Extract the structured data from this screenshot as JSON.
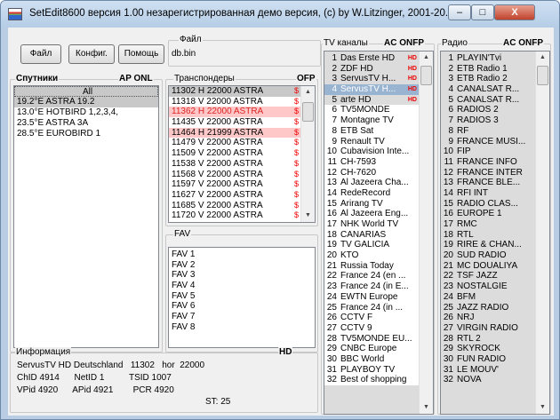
{
  "window": {
    "title": "SetEdit8600 версия  1.00  незарегистрированная демо версия, (c) by W.Litzinger, 2001-20...",
    "controls": {
      "minimize": "–",
      "maximize": "□",
      "close": "X"
    }
  },
  "toolbar": {
    "file_label": "Файл",
    "config_label": "Конфиг.",
    "help_label": "Помощь"
  },
  "file_box": {
    "label": "Файл",
    "value": "db.bin"
  },
  "satellites": {
    "label": "Спутники",
    "flags": "AP  ONL",
    "items": [
      "All",
      "19.2°E ASTRA 19.2",
      "13.0°E HOTBIRD 1,2,3,4,",
      "23.5°E ASTRA 3A",
      "28.5°E EUROBIRD 1"
    ]
  },
  "transponders": {
    "label": "Транспондеры",
    "flags": "OFP",
    "items": [
      "11302  H  22000  ASTRA",
      "11318  V  22000  ASTRA",
      "11362  H  22000  ASTRA",
      "11435  V  22000  ASTRA",
      "11464  H  21999  ASTRA",
      "11479  V  22000  ASTRA",
      "11509  V  22000  ASTRA",
      "11538  V  22000  ASTRA",
      "11568  V  22000  ASTRA",
      "11597  V  22000  ASTRA",
      "11627  V  22000  ASTRA",
      "11685  V  22000  ASTRA",
      "11720  V  22000  ASTRA"
    ]
  },
  "fav": {
    "label": "FAV",
    "items": [
      "FAV 1",
      "FAV 2",
      "FAV 3",
      "FAV 4",
      "FAV 5",
      "FAV 6",
      "FAV 7",
      "FAV 8"
    ]
  },
  "tv": {
    "label": "TV каналы",
    "flags": "AC  ONFP",
    "items": [
      {
        "n": "1",
        "name": "Das Erste HD",
        "hd": "HD"
      },
      {
        "n": "2",
        "name": "ZDF HD",
        "hd": "HD"
      },
      {
        "n": "3",
        "name": "ServusTV H...",
        "hd": "HD"
      },
      {
        "n": "4",
        "name": "ServusTV H...",
        "hd": "HD"
      },
      {
        "n": "5",
        "name": "arte HD",
        "hd": "HD"
      },
      {
        "n": "6",
        "name": "TV5MONDE",
        "hd": ""
      },
      {
        "n": "7",
        "name": "Montagne TV",
        "hd": ""
      },
      {
        "n": "8",
        "name": "ETB Sat",
        "hd": ""
      },
      {
        "n": "9",
        "name": "Renault TV",
        "hd": ""
      },
      {
        "n": "10",
        "name": "Cubavision Inte...",
        "hd": ""
      },
      {
        "n": "11",
        "name": "CH-7593",
        "hd": ""
      },
      {
        "n": "12",
        "name": "CH-7620",
        "hd": ""
      },
      {
        "n": "13",
        "name": "Al Jazeera Cha...",
        "hd": ""
      },
      {
        "n": "14",
        "name": "RedeRecord",
        "hd": ""
      },
      {
        "n": "15",
        "name": "Arirang TV",
        "hd": ""
      },
      {
        "n": "16",
        "name": "Al Jazeera Eng...",
        "hd": ""
      },
      {
        "n": "17",
        "name": "NHK World TV",
        "hd": ""
      },
      {
        "n": "18",
        "name": "CANARIAS",
        "hd": ""
      },
      {
        "n": "19",
        "name": "TV GALICIA",
        "hd": ""
      },
      {
        "n": "20",
        "name": "KTO",
        "hd": ""
      },
      {
        "n": "21",
        "name": "Russia Today",
        "hd": ""
      },
      {
        "n": "22",
        "name": "France 24 (en ...",
        "hd": ""
      },
      {
        "n": "23",
        "name": "France 24 (in E...",
        "hd": ""
      },
      {
        "n": "24",
        "name": "EWTN Europe",
        "hd": ""
      },
      {
        "n": "25",
        "name": "France 24 (in ...",
        "hd": ""
      },
      {
        "n": "26",
        "name": "CCTV F",
        "hd": ""
      },
      {
        "n": "27",
        "name": "CCTV 9",
        "hd": ""
      },
      {
        "n": "28",
        "name": "TV5MONDE EU...",
        "hd": ""
      },
      {
        "n": "29",
        "name": "CNBC Europe",
        "hd": ""
      },
      {
        "n": "30",
        "name": "BBC World",
        "hd": ""
      },
      {
        "n": "31",
        "name": "PLAYBOY TV",
        "hd": ""
      },
      {
        "n": "32",
        "name": "Best of shopping",
        "hd": ""
      }
    ]
  },
  "radio": {
    "label": "Радио",
    "flags": "AC  ONFP",
    "items": [
      {
        "n": "1",
        "name": "PLAYIN'Tvi"
      },
      {
        "n": "2",
        "name": "ETB Radio 1"
      },
      {
        "n": "3",
        "name": "ETB Radio 2"
      },
      {
        "n": "4",
        "name": "CANALSAT R..."
      },
      {
        "n": "5",
        "name": "CANALSAT R..."
      },
      {
        "n": "6",
        "name": "RADIOS 2"
      },
      {
        "n": "7",
        "name": "RADIOS 3"
      },
      {
        "n": "8",
        "name": "RF"
      },
      {
        "n": "9",
        "name": "FRANCE MUSI..."
      },
      {
        "n": "10",
        "name": "FIP"
      },
      {
        "n": "11",
        "name": "FRANCE INFO"
      },
      {
        "n": "12",
        "name": "FRANCE INTER"
      },
      {
        "n": "13",
        "name": "FRANCE BLE..."
      },
      {
        "n": "14",
        "name": "RFI INT"
      },
      {
        "n": "15",
        "name": "RADIO CLAS..."
      },
      {
        "n": "16",
        "name": "EUROPE 1"
      },
      {
        "n": "17",
        "name": "RMC"
      },
      {
        "n": "18",
        "name": "RTL"
      },
      {
        "n": "19",
        "name": "RIRE & CHAN..."
      },
      {
        "n": "20",
        "name": "SUD RADIO"
      },
      {
        "n": "21",
        "name": "MC DOUALIYA"
      },
      {
        "n": "22",
        "name": "TSF JAZZ"
      },
      {
        "n": "23",
        "name": "NOSTALGIE"
      },
      {
        "n": "24",
        "name": "BFM"
      },
      {
        "n": "25",
        "name": "JAZZ RADIO"
      },
      {
        "n": "26",
        "name": "NRJ"
      },
      {
        "n": "27",
        "name": "VIRGIN RADIO"
      },
      {
        "n": "28",
        "name": "RTL 2"
      },
      {
        "n": "29",
        "name": "SKYROCK"
      },
      {
        "n": "30",
        "name": "FUN RADIO"
      },
      {
        "n": "31",
        "name": "LE MOUV'"
      },
      {
        "n": "32",
        "name": "NOVA"
      }
    ]
  },
  "info": {
    "label": "Информация",
    "hd": "HD",
    "line1": "ServusTV HD Deutschland   11302   hor  22000",
    "line2": "ChID 4914      NetID 1          TSID 1007",
    "line3": "VPid 4920      APid 4921        PCR 4920",
    "st": "ST: 25"
  }
}
